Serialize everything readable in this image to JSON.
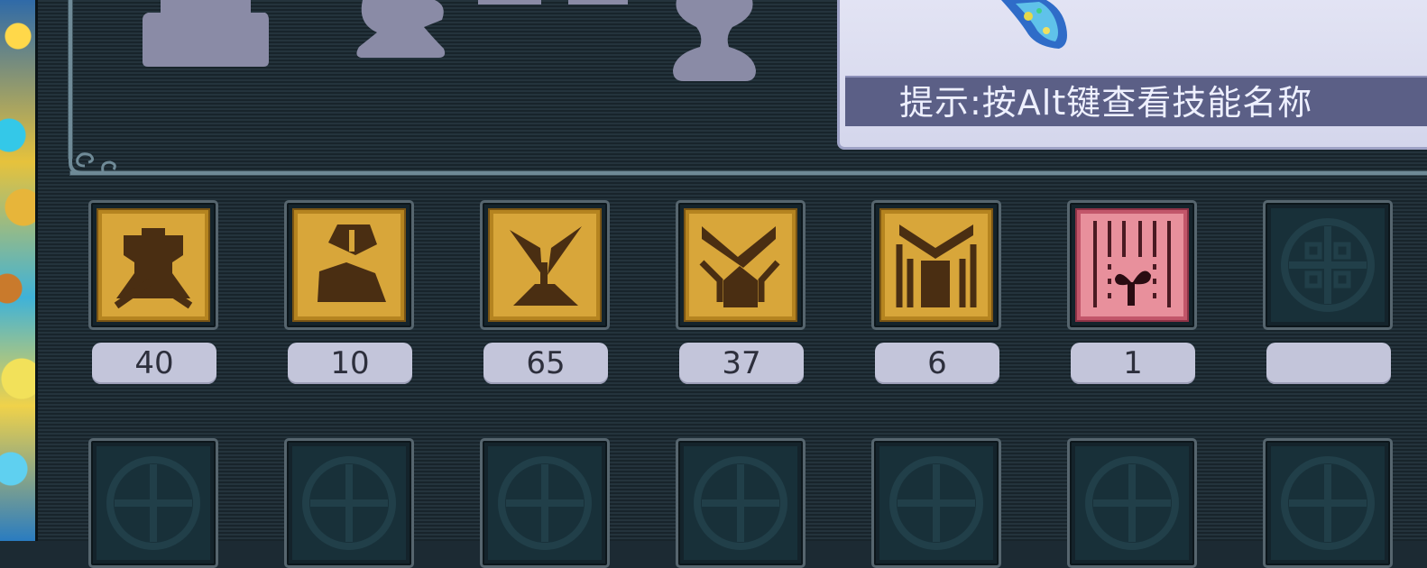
{
  "hint": {
    "text": "提示:按Alt键查看技能名称"
  },
  "skill_row_1": [
    {
      "icon": "fist-rune-icon",
      "count": "40",
      "style": "gold"
    },
    {
      "icon": "flag-rune-icon",
      "count": "10",
      "style": "gold"
    },
    {
      "icon": "sprout-rune-icon",
      "count": "65",
      "style": "gold"
    },
    {
      "icon": "arrow-rune-icon",
      "count": "37",
      "style": "gold"
    },
    {
      "icon": "gate-rune-icon",
      "count": "6",
      "style": "gold"
    },
    {
      "icon": "seedling-rune-icon",
      "count": "1",
      "style": "pink"
    },
    {
      "icon": "empty-slot-emblem-icon",
      "count": "",
      "style": "empty"
    }
  ],
  "colors": {
    "gold": "#c99a2a",
    "pink": "#e07b86",
    "empty": "#183039"
  }
}
